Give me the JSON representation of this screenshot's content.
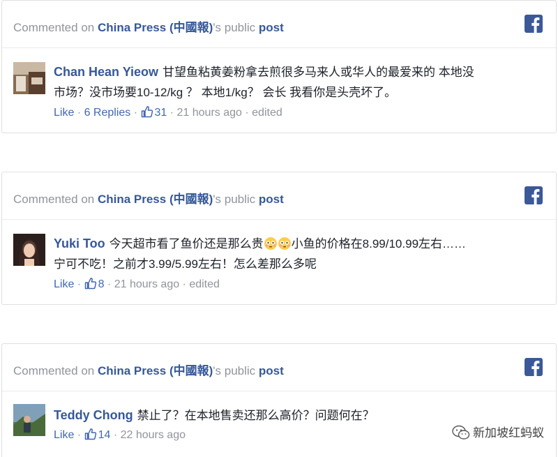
{
  "header": {
    "prefix": "Commented on ",
    "page_name": "China Press (中國報)",
    "middle": "'s public ",
    "post_label": "post",
    "icon": "facebook-icon"
  },
  "comments": [
    {
      "author": "Chan Hean Yieow",
      "text_lines": [
        "甘望鱼粘黄姜粉拿去煎很多马来人或华人的最爱来的 本地没",
        "市场？没市场要10-12/kg ？ 本地1/kg？ 会长 我看你是头壳坏了。"
      ],
      "like_label": "Like",
      "replies_label": "6 Replies",
      "reactions": "31",
      "time": "21 hours ago",
      "edited": "edited"
    },
    {
      "author": "Yuki Too",
      "text_a": "今天超市看了鱼价还是那么贵",
      "text_b": "小鱼的价格在8.99/10.99左右……",
      "text_line2": "宁可不吃！之前才3.99/5.99左右！怎么差那么多呢",
      "like_label": "Like",
      "reactions": "8",
      "time": "21 hours ago",
      "edited": "edited"
    },
    {
      "author": "Teddy Chong",
      "text": "禁止了？在本地售卖还那么高价？问题何在？",
      "like_label": "Like",
      "reactions": "14",
      "time": "22 hours ago"
    }
  ],
  "watermark": "新加坡红蚂蚁",
  "colors": {
    "link": "#365899",
    "facebook_blue": "#3b5998",
    "meta_gray": "#90949c"
  }
}
